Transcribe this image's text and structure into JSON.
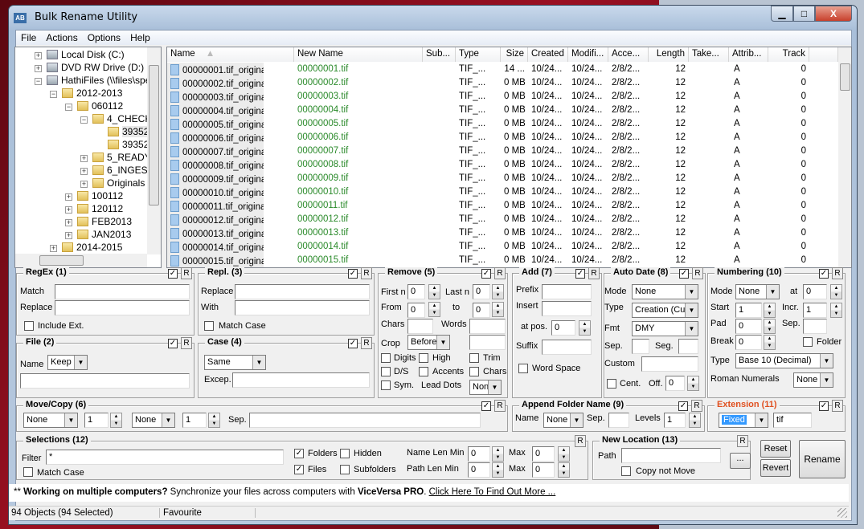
{
  "window": {
    "title": "Bulk Rename Utility",
    "app_icon": "AB",
    "min": "▁",
    "max": "□",
    "close": "X"
  },
  "menu": [
    "File",
    "Actions",
    "Options",
    "Help"
  ],
  "tree": [
    {
      "label": "Local Disk (C:)",
      "level": 0,
      "toggle": "+",
      "icon": "drive"
    },
    {
      "label": "DVD RW Drive (D:)",
      "level": 0,
      "toggle": "+",
      "icon": "dvd"
    },
    {
      "label": "HathiFiles (\\\\files\\spec",
      "level": 0,
      "toggle": "-",
      "icon": "network-drive"
    },
    {
      "label": "2012-2013",
      "level": 1,
      "toggle": "-"
    },
    {
      "label": "060112",
      "level": 2,
      "toggle": "-"
    },
    {
      "label": "4_CHECK",
      "level": 3,
      "toggle": "-"
    },
    {
      "label": "39352",
      "level": 4,
      "toggle": ""
    },
    {
      "label": "39352",
      "level": 4,
      "toggle": ""
    },
    {
      "label": "5_READY",
      "level": 3,
      "toggle": "+"
    },
    {
      "label": "6_INGEST",
      "level": 3,
      "toggle": "+"
    },
    {
      "label": "Originals",
      "level": 3,
      "toggle": "+"
    },
    {
      "label": "100112",
      "level": 2,
      "toggle": "+"
    },
    {
      "label": "120112",
      "level": 2,
      "toggle": "+"
    },
    {
      "label": "FEB2013",
      "level": 2,
      "toggle": "+"
    },
    {
      "label": "JAN2013",
      "level": 2,
      "toggle": "+"
    },
    {
      "label": "2014-2015",
      "level": 1,
      "toggle": "+"
    }
  ],
  "columns": [
    "Name",
    "New Name",
    "Sub...",
    "Type",
    "Size",
    "Created",
    "Modifi...",
    "Acce...",
    "Length",
    "Take...",
    "Attrib...",
    "Track"
  ],
  "sort_column": "Name",
  "files": [
    [
      "00000001.tif_original",
      "00000001.tif",
      "",
      "TIF_...",
      "14 ...",
      "10/24...",
      "10/24...",
      "2/8/2...",
      "12",
      "",
      "A",
      "0"
    ],
    [
      "00000002.tif_original",
      "00000002.tif",
      "",
      "TIF_...",
      "0 MB",
      "10/24...",
      "10/24...",
      "2/8/2...",
      "12",
      "",
      "A",
      "0"
    ],
    [
      "00000003.tif_original",
      "00000003.tif",
      "",
      "TIF_...",
      "0 MB",
      "10/24...",
      "10/24...",
      "2/8/2...",
      "12",
      "",
      "A",
      "0"
    ],
    [
      "00000004.tif_original",
      "00000004.tif",
      "",
      "TIF_...",
      "0 MB",
      "10/24...",
      "10/24...",
      "2/8/2...",
      "12",
      "",
      "A",
      "0"
    ],
    [
      "00000005.tif_original",
      "00000005.tif",
      "",
      "TIF_...",
      "0 MB",
      "10/24...",
      "10/24...",
      "2/8/2...",
      "12",
      "",
      "A",
      "0"
    ],
    [
      "00000006.tif_original",
      "00000006.tif",
      "",
      "TIF_...",
      "0 MB",
      "10/24...",
      "10/24...",
      "2/8/2...",
      "12",
      "",
      "A",
      "0"
    ],
    [
      "00000007.tif_original",
      "00000007.tif",
      "",
      "TIF_...",
      "0 MB",
      "10/24...",
      "10/24...",
      "2/8/2...",
      "12",
      "",
      "A",
      "0"
    ],
    [
      "00000008.tif_original",
      "00000008.tif",
      "",
      "TIF_...",
      "0 MB",
      "10/24...",
      "10/24...",
      "2/8/2...",
      "12",
      "",
      "A",
      "0"
    ],
    [
      "00000009.tif_original",
      "00000009.tif",
      "",
      "TIF_...",
      "0 MB",
      "10/24...",
      "10/24...",
      "2/8/2...",
      "12",
      "",
      "A",
      "0"
    ],
    [
      "00000010.tif_original",
      "00000010.tif",
      "",
      "TIF_...",
      "0 MB",
      "10/24...",
      "10/24...",
      "2/8/2...",
      "12",
      "",
      "A",
      "0"
    ],
    [
      "00000011.tif_original",
      "00000011.tif",
      "",
      "TIF_...",
      "0 MB",
      "10/24...",
      "10/24...",
      "2/8/2...",
      "12",
      "",
      "A",
      "0"
    ],
    [
      "00000012.tif_original",
      "00000012.tif",
      "",
      "TIF_...",
      "0 MB",
      "10/24...",
      "10/24...",
      "2/8/2...",
      "12",
      "",
      "A",
      "0"
    ],
    [
      "00000013.tif_original",
      "00000013.tif",
      "",
      "TIF_...",
      "0 MB",
      "10/24...",
      "10/24...",
      "2/8/2...",
      "12",
      "",
      "A",
      "0"
    ],
    [
      "00000014.tif_original",
      "00000014.tif",
      "",
      "TIF_...",
      "0 MB",
      "10/24...",
      "10/24...",
      "2/8/2...",
      "12",
      "",
      "A",
      "0"
    ],
    [
      "00000015.tif_original",
      "00000015.tif",
      "",
      "TIF_...",
      "0 MB",
      "10/24...",
      "10/24...",
      "2/8/2...",
      "12",
      "",
      "A",
      "0"
    ]
  ],
  "colors": {
    "new_name": "#2a8a2a",
    "extension_title": "#e05020",
    "selected": "#3399ff"
  },
  "check": "✓",
  "r": "R",
  "regex": {
    "title": "RegEx (1)",
    "match": "Match",
    "replace": "Replace",
    "include_ext": "Include Ext."
  },
  "repl": {
    "title": "Repl. (3)",
    "replace": "Replace",
    "with": "With",
    "match_case": "Match Case"
  },
  "remove": {
    "title": "Remove (5)",
    "first_n": "First n",
    "first_n_val": "0",
    "last_n": "Last n",
    "last_n_val": "0",
    "from": "From",
    "from_val": "0",
    "to": "to",
    "to_val": "0",
    "chars": "Chars",
    "words": "Words",
    "crop": "Crop",
    "crop_val": "Before",
    "digits": "Digits",
    "high": "High",
    "trim": "Trim",
    "ds": "D/S",
    "accents": "Accents",
    "chars2": "Chars",
    "sym": "Sym.",
    "lead_dots": "Lead Dots",
    "lead_dots_val": "Non"
  },
  "add": {
    "title": "Add (7)",
    "prefix": "Prefix",
    "insert": "Insert",
    "at_pos": "at pos.",
    "at_pos_val": "0",
    "suffix": "Suffix",
    "word_space": "Word Space"
  },
  "autodate": {
    "title": "Auto Date (8)",
    "mode": "Mode",
    "mode_val": "None",
    "type": "Type",
    "type_val": "Creation (Cur",
    "fmt": "Fmt",
    "fmt_val": "DMY",
    "sep": "Sep.",
    "seg": "Seg.",
    "custom": "Custom",
    "cent": "Cent.",
    "off": "Off.",
    "off_val": "0"
  },
  "numbering": {
    "title": "Numbering (10)",
    "mode": "Mode",
    "mode_val": "None",
    "at": "at",
    "at_val": "0",
    "start": "Start",
    "start_val": "1",
    "incr": "Incr.",
    "incr_val": "1",
    "pad": "Pad",
    "pad_val": "0",
    "sep": "Sep.",
    "break": "Break",
    "break_val": "0",
    "folder": "Folder",
    "type": "Type",
    "type_val": "Base 10 (Decimal)",
    "roman": "Roman Numerals",
    "roman_val": "None"
  },
  "file": {
    "title": "File (2)",
    "name": "Name",
    "name_val": "Keep"
  },
  "case": {
    "title": "Case (4)",
    "case_val": "Same",
    "excep": "Excep."
  },
  "movecopy": {
    "title": "Move/Copy (6)",
    "mode1": "None",
    "n1": "1",
    "mode2": "None",
    "n2": "1",
    "sep": "Sep."
  },
  "appendfolder": {
    "title": "Append Folder Name (9)",
    "name": "Name",
    "name_val": "None",
    "sep": "Sep.",
    "levels": "Levels",
    "levels_val": "1"
  },
  "extension": {
    "title": "Extension (11)",
    "mode_val": "Fixed",
    "ext_val": "tif"
  },
  "selections": {
    "title": "Selections (12)",
    "filter": "Filter",
    "filter_val": "*",
    "match_case": "Match Case",
    "folders": "Folders",
    "hidden": "Hidden",
    "files": "Files",
    "subfolders": "Subfolders",
    "name_len_min": "Name Len Min",
    "name_len_min_val": "0",
    "max": "Max",
    "name_len_max_val": "0",
    "path_len_min": "Path Len Min",
    "path_len_min_val": "0",
    "path_len_max_val": "0"
  },
  "newlocation": {
    "title": "New Location (13)",
    "path": "Path",
    "browse": "...",
    "copy_not_move": "Copy not Move"
  },
  "buttons": {
    "reset": "Reset",
    "revert": "Revert",
    "rename": "Rename"
  },
  "promo": {
    "prefix": "** ",
    "bold": "Working on multiple computers?",
    "text": " Synchronize your files across computers with ",
    "product": "ViceVersa PRO",
    "dot": ". ",
    "link": "Click Here To Find Out More ..."
  },
  "status": {
    "objects": "94 Objects (94 Selected)",
    "favourite": "Favourite"
  }
}
